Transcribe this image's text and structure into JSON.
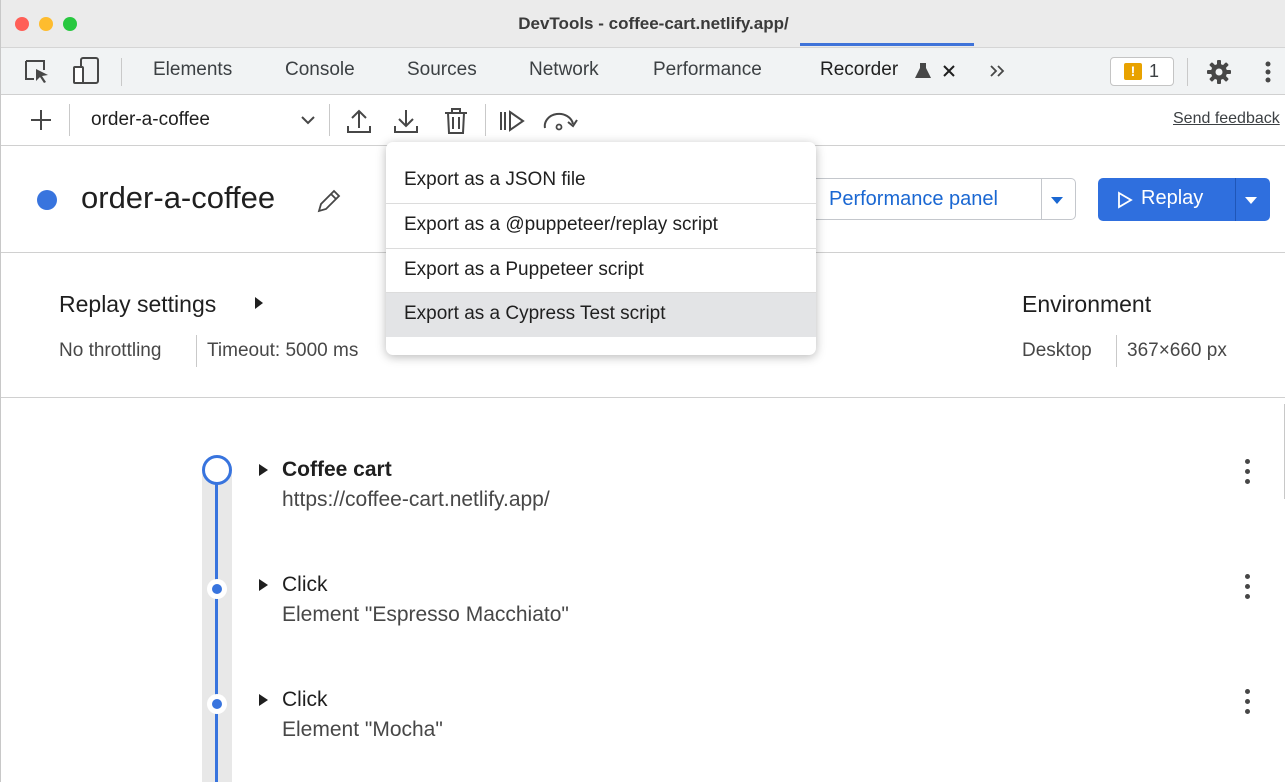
{
  "window": {
    "title": "DevTools - coffee-cart.netlify.app/"
  },
  "tabs": [
    {
      "label": "Elements"
    },
    {
      "label": "Console"
    },
    {
      "label": "Sources"
    },
    {
      "label": "Network"
    },
    {
      "label": "Performance"
    },
    {
      "label": "Recorder"
    }
  ],
  "issues_badge": {
    "count": "1"
  },
  "toolbar": {
    "recording_select": "order-a-coffee",
    "send_feedback": "Send feedback"
  },
  "recording": {
    "title": "order-a-coffee",
    "performance_button": "Performance panel",
    "replay_button": "Replay"
  },
  "export_menu": {
    "items": [
      {
        "label": "Export as a JSON file"
      },
      {
        "label": "Export as a @puppeteer/replay script"
      },
      {
        "label": "Export as a Puppeteer script"
      },
      {
        "label": "Export as a Cypress Test script"
      }
    ],
    "highlighted_index": 3
  },
  "replay_settings": {
    "title": "Replay settings",
    "throttling": "No throttling",
    "timeout": "Timeout: 5000 ms"
  },
  "environment": {
    "title": "Environment",
    "device": "Desktop",
    "size": "367×660 px"
  },
  "steps": [
    {
      "title": "Coffee cart",
      "subtitle": "https://coffee-cart.netlify.app/"
    },
    {
      "title": "Click",
      "subtitle": "Element \"Espresso Macchiato\""
    },
    {
      "title": "Click",
      "subtitle": "Element \"Mocha\""
    }
  ],
  "colors": {
    "accent": "#3874de",
    "replay_button": "#2f6fde",
    "link_blue": "#1a67d2",
    "menu_highlight": "#e3e4e6",
    "traffic_red": "#ff5f57",
    "traffic_yellow": "#febc2e",
    "traffic_green": "#28c840",
    "badge_orange": "#e8a200"
  }
}
